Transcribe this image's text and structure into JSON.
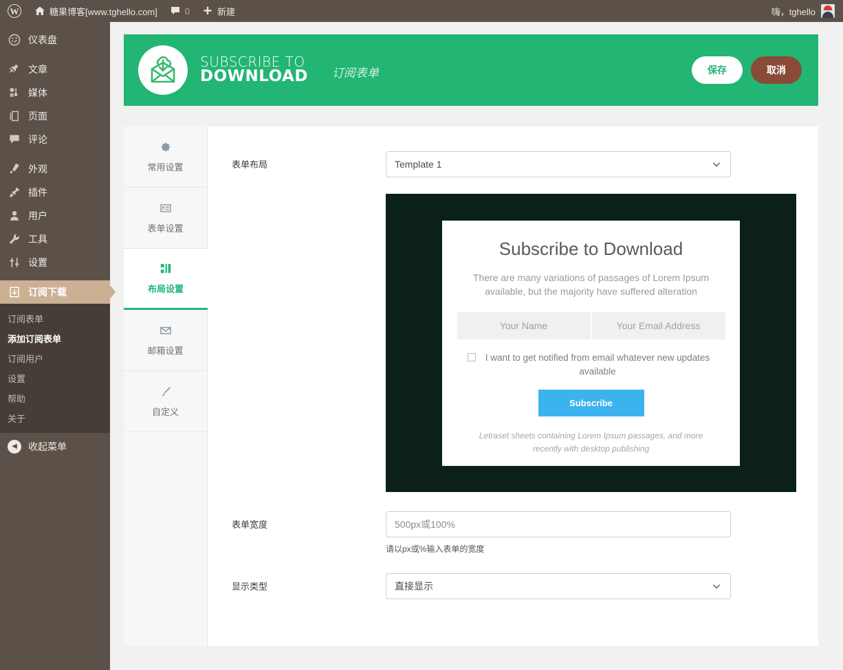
{
  "adminbar": {
    "wp_logo": "wordpress-logo",
    "site_name": "糖果博客[www.tghello.com]",
    "comment_count": "0",
    "new_label": "新建",
    "greeting": "嗨，tghello"
  },
  "sidebar": {
    "items": [
      {
        "label": "仪表盘",
        "icon": "dashboard-icon"
      },
      {
        "label": "文章",
        "icon": "pin-icon"
      },
      {
        "label": "媒体",
        "icon": "media-icon"
      },
      {
        "label": "页面",
        "icon": "page-icon"
      },
      {
        "label": "评论",
        "icon": "comment-icon"
      },
      {
        "label": "外观",
        "icon": "appearance-icon"
      },
      {
        "label": "插件",
        "icon": "plugin-icon"
      },
      {
        "label": "用户",
        "icon": "user-icon"
      },
      {
        "label": "工具",
        "icon": "tools-icon"
      },
      {
        "label": "设置",
        "icon": "settings-icon"
      },
      {
        "label": "订阅下载",
        "icon": "download-icon"
      }
    ],
    "submenu": [
      {
        "label": "订阅表单",
        "current": false
      },
      {
        "label": "添加订阅表单",
        "current": true
      },
      {
        "label": "订阅用户",
        "current": false
      },
      {
        "label": "设置",
        "current": false
      },
      {
        "label": "帮助",
        "current": false
      },
      {
        "label": "关于",
        "current": false
      }
    ],
    "collapse_label": "收起菜单",
    "active_bg": "#cbb094"
  },
  "banner": {
    "brand_line1": "SUBSCRIBE TO",
    "brand_line2": "DOWNLOAD",
    "subtitle": "订阅表单",
    "save_label": "保存",
    "cancel_label": "取消",
    "bg_color": "#22b573",
    "cancel_color": "#8a4a38"
  },
  "tabs": [
    {
      "label": "常用设置",
      "icon": "gear-icon",
      "active": false
    },
    {
      "label": "表单设置",
      "icon": "form-icon",
      "active": false
    },
    {
      "label": "布局设置",
      "icon": "layout-icon",
      "active": true
    },
    {
      "label": "邮箱设置",
      "icon": "envelope-icon",
      "active": false
    },
    {
      "label": "自定义",
      "icon": "brush-icon",
      "active": false
    }
  ],
  "form": {
    "layout_label": "表单布局",
    "layout_value": "Template 1",
    "width_label": "表单宽度",
    "width_placeholder": "500px或100%",
    "width_helper": "请以px或%输入表单的宽度",
    "display_label": "显示类型",
    "display_value": "直接显示"
  },
  "preview": {
    "title": "Subscribe to Download",
    "description": "There are many variations of passages of Lorem Ipsum available, but the majority have suffered alteration",
    "name_placeholder": "Your Name",
    "email_placeholder": "Your Email Address",
    "checkbox_label": "I want to get notified from email whatever new updates available",
    "button_label": "Subscribe",
    "footer_note": "Letraset sheets containing Lorem Ipsum passages, and more recently with desktop publishing",
    "bg_color": "#0a2018",
    "button_color": "#3cb3ef"
  }
}
